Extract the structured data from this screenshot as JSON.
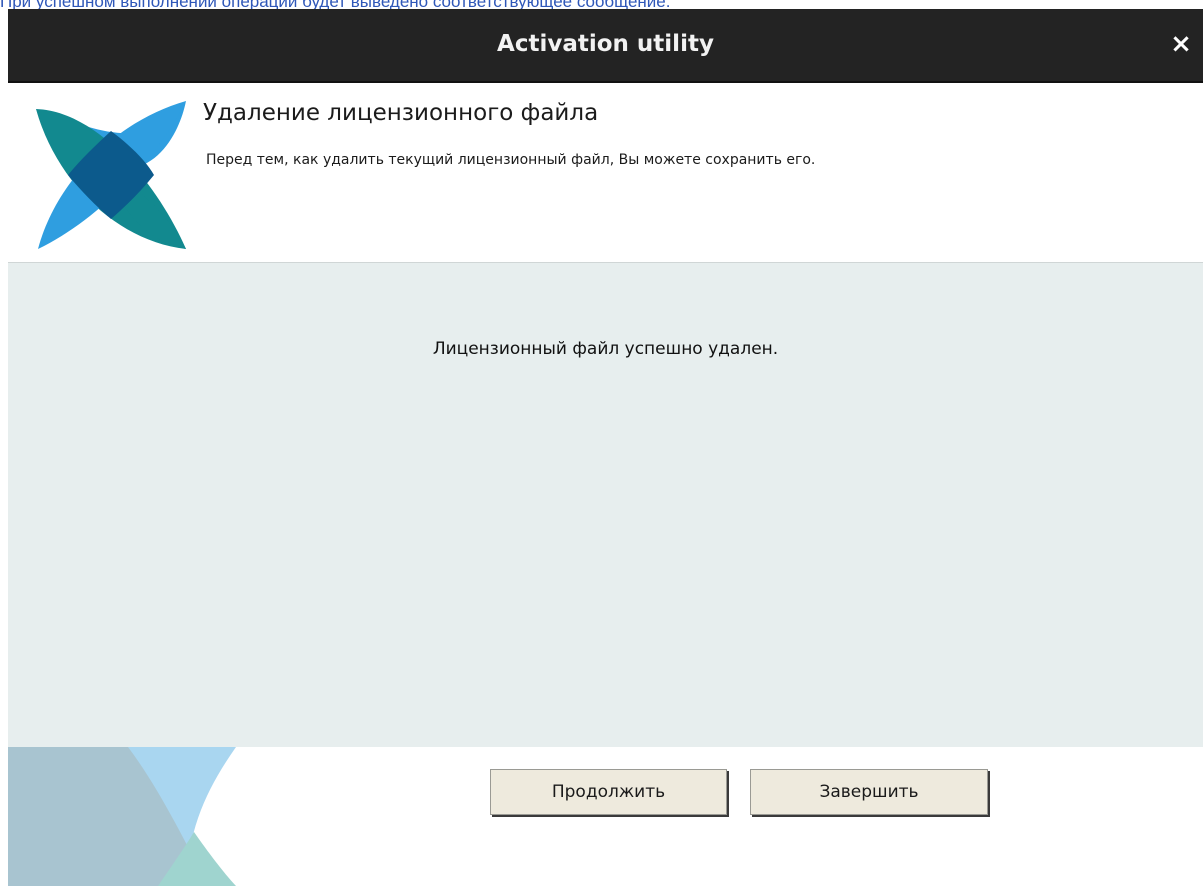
{
  "document": {
    "top_text": "При успешном выполнении операции будет выведено соответствующее сообщение."
  },
  "window": {
    "title": "Activation utility",
    "close_glyph": "×"
  },
  "header": {
    "title": "Удаление лицензионного файла",
    "subtitle": "Перед тем, как удалить текущий лицензионный файл, Вы можете сохранить его.",
    "logo_icon": "activation-logo-icon"
  },
  "content": {
    "message": "Лицензионный файл успешно удален."
  },
  "buttons": {
    "continue_label": "Продолжить",
    "finish_label": "Завершить"
  },
  "colors": {
    "titlebar": "#232323",
    "content_bg": "#e7eeee",
    "button_bg": "#eeeadd",
    "logo_blue": "#2f9ee0",
    "logo_teal": "#12898f",
    "logo_dark": "#0c5a8c",
    "link_blue": "#2f57b8"
  }
}
